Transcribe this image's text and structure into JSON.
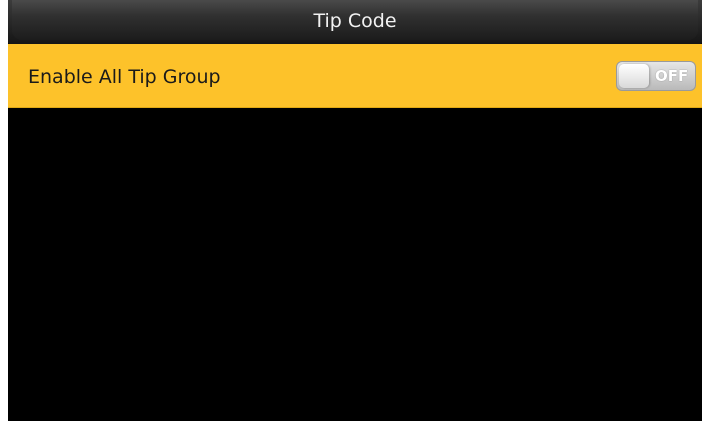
{
  "header": {
    "title": "Tip Code"
  },
  "settings": {
    "items": [
      {
        "label": "Enable All Tip Group",
        "toggle_state": "OFF",
        "enabled": false
      }
    ]
  },
  "colors": {
    "accent": "#fdc22a",
    "background": "#000000",
    "title_text": "#f2f2f2"
  }
}
